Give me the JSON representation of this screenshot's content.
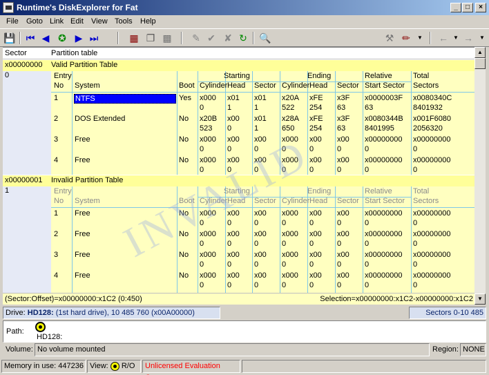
{
  "window": {
    "title": "Runtime's DiskExplorer for Fat",
    "min": "_",
    "max": "□",
    "close": "×"
  },
  "menu": [
    "File",
    "Goto",
    "Link",
    "Edit",
    "View",
    "Tools",
    "Help"
  ],
  "header": {
    "sector": "Sector",
    "partition": "Partition table"
  },
  "colhdr": {
    "entry": "Entry",
    "no": "No",
    "system": "System",
    "boot": "Boot",
    "starting": "Starting",
    "ending": "Ending",
    "relative": "Relative",
    "total": "Total",
    "cylinder": "Cylinder",
    "head": "Head",
    "sector": "Sector",
    "start_sector": "Start Sector",
    "sectors": "Sectors"
  },
  "section1": {
    "addr": "x00000000",
    "idx": "0",
    "title": "Valid Partition Table",
    "rows": [
      {
        "no": "1",
        "system": "NTFS",
        "boot": "Yes",
        "sc1": "x000",
        "sc2": "0",
        "sh1": "x01",
        "sh2": "1",
        "ss1": "x01",
        "ss2": "1",
        "ec1": "x20A",
        "ec2": "522",
        "eh1": "xFE",
        "eh2": "254",
        "es1": "x3F",
        "es2": "63",
        "rs1": "x0000003F",
        "rs2": "63",
        "ts1": "x0080340C",
        "ts2": "8401932"
      },
      {
        "no": "2",
        "system": "DOS Extended",
        "boot": "No",
        "sc1": "x20B",
        "sc2": "523",
        "sh1": "x00",
        "sh2": "0",
        "ss1": "x01",
        "ss2": "1",
        "ec1": "x28A",
        "ec2": "650",
        "eh1": "xFE",
        "eh2": "254",
        "es1": "x3F",
        "es2": "63",
        "rs1": "x0080344B",
        "rs2": "8401995",
        "ts1": "x001F6080",
        "ts2": "2056320"
      },
      {
        "no": "3",
        "system": "Free",
        "boot": "No",
        "sc1": "x000",
        "sc2": "0",
        "sh1": "x00",
        "sh2": "0",
        "ss1": "x00",
        "ss2": "0",
        "ec1": "x000",
        "ec2": "0",
        "eh1": "x00",
        "eh2": "0",
        "es1": "x00",
        "es2": "0",
        "rs1": "x00000000",
        "rs2": "0",
        "ts1": "x00000000",
        "ts2": "0"
      },
      {
        "no": "4",
        "system": "Free",
        "boot": "No",
        "sc1": "x000",
        "sc2": "0",
        "sh1": "x00",
        "sh2": "0",
        "ss1": "x00",
        "ss2": "0",
        "ec1": "x000",
        "ec2": "0",
        "eh1": "x00",
        "eh2": "0",
        "es1": "x00",
        "es2": "0",
        "rs1": "x00000000",
        "rs2": "0",
        "ts1": "x00000000",
        "ts2": "0"
      }
    ]
  },
  "section2": {
    "addr": "x00000001",
    "idx": "1",
    "title": "Invalid Partition Table",
    "watermark": "INVALID",
    "rows": [
      {
        "no": "1",
        "system": "Free",
        "boot": "No",
        "sc1": "x000",
        "sc2": "0",
        "sh1": "x00",
        "sh2": "0",
        "ss1": "x00",
        "ss2": "0",
        "ec1": "x000",
        "ec2": "0",
        "eh1": "x00",
        "eh2": "0",
        "es1": "x00",
        "es2": "0",
        "rs1": "x00000000",
        "rs2": "0",
        "ts1": "x00000000",
        "ts2": "0"
      },
      {
        "no": "2",
        "system": "Free",
        "boot": "No",
        "sc1": "x000",
        "sc2": "0",
        "sh1": "x00",
        "sh2": "0",
        "ss1": "x00",
        "ss2": "0",
        "ec1": "x000",
        "ec2": "0",
        "eh1": "x00",
        "eh2": "0",
        "es1": "x00",
        "es2": "0",
        "rs1": "x00000000",
        "rs2": "0",
        "ts1": "x00000000",
        "ts2": "0"
      },
      {
        "no": "3",
        "system": "Free",
        "boot": "No",
        "sc1": "x000",
        "sc2": "0",
        "sh1": "x00",
        "sh2": "0",
        "ss1": "x00",
        "ss2": "0",
        "ec1": "x000",
        "ec2": "0",
        "eh1": "x00",
        "eh2": "0",
        "es1": "x00",
        "es2": "0",
        "rs1": "x00000000",
        "rs2": "0",
        "ts1": "x00000000",
        "ts2": "0"
      },
      {
        "no": "4",
        "system": "Free",
        "boot": "No",
        "sc1": "x000",
        "sc2": "0",
        "sh1": "x00",
        "sh2": "0",
        "ss1": "x00",
        "ss2": "0",
        "ec1": "x000",
        "ec2": "0",
        "eh1": "x00",
        "eh2": "0",
        "es1": "x00",
        "es2": "0",
        "rs1": "x00000000",
        "rs2": "0",
        "ts1": "x00000000",
        "ts2": "0"
      }
    ]
  },
  "offset_status": "(Sector:Offset)=x00000000:x1C2 (0:450)",
  "selection_status": "Selection=x00000000:x1C2-x00000000:x1C2",
  "drive": {
    "label": "Drive:",
    "name": "HD128:",
    "info": "(1st hard drive), 10 485 760 (x00A00000) sectors",
    "sectors": "Sectors 0-10 485 759"
  },
  "path": {
    "label": "Path:",
    "value": "HD128:"
  },
  "volume": {
    "label": "Volume:",
    "value": "No volume mounted",
    "region_label": "Region:",
    "region_value": "NONE"
  },
  "status": {
    "memory": "Memory in use: 447236",
    "view_label": "View:",
    "mode": "R/O",
    "license": "Unlicensed Evaluation Copy"
  },
  "colors": {
    "titlebar": "#0a246a",
    "highlight": "#ffff99",
    "grid": "#7ec7e8",
    "license_text": "#ff0000",
    "selection": "#0000ff"
  }
}
